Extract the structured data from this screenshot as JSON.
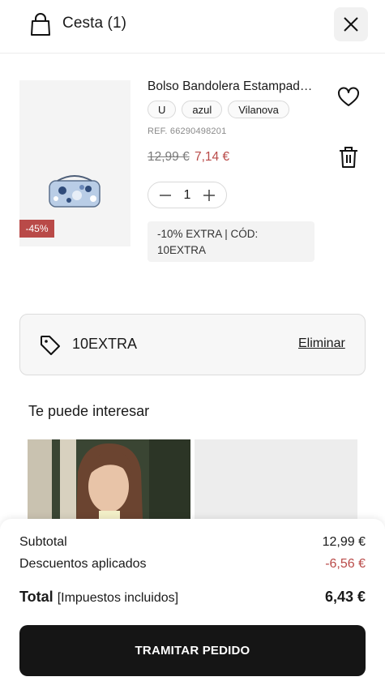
{
  "header": {
    "title": "Cesta (1)",
    "icons": {
      "bag": "shopping-bag-icon",
      "close": "close-icon"
    }
  },
  "product": {
    "name": "Bolso Bandolera Estampad…",
    "discount_badge": "-45%",
    "chips": [
      "U",
      "azul",
      "Vilanova"
    ],
    "ref": "REF. 66290498201",
    "price_original": "12,99 €",
    "price_current": "7,14 €",
    "quantity": "1",
    "promo_line1": "-10% EXTRA | CÓD:",
    "promo_line2": "10EXTRA",
    "icons": {
      "wishlist": "heart-icon",
      "delete": "trash-icon",
      "decrease": "minus-icon",
      "increase": "plus-icon"
    }
  },
  "coupon": {
    "code": "10EXTRA",
    "remove_label": "Eliminar",
    "icon": "tag-icon"
  },
  "recommendations": {
    "title": "Te puede interesar"
  },
  "summary": {
    "subtotal_label": "Subtotal",
    "subtotal_value": "12,99 €",
    "discounts_label": "Descuentos aplicados",
    "discounts_value": "-6,56 €",
    "total_label": "Total",
    "total_note": "[Impuestos incluidos]",
    "total_value": "6,43 €",
    "checkout_label": "TRAMITAR PEDIDO"
  },
  "colors": {
    "accent_red": "#b94a48",
    "button_dark": "#151515"
  }
}
